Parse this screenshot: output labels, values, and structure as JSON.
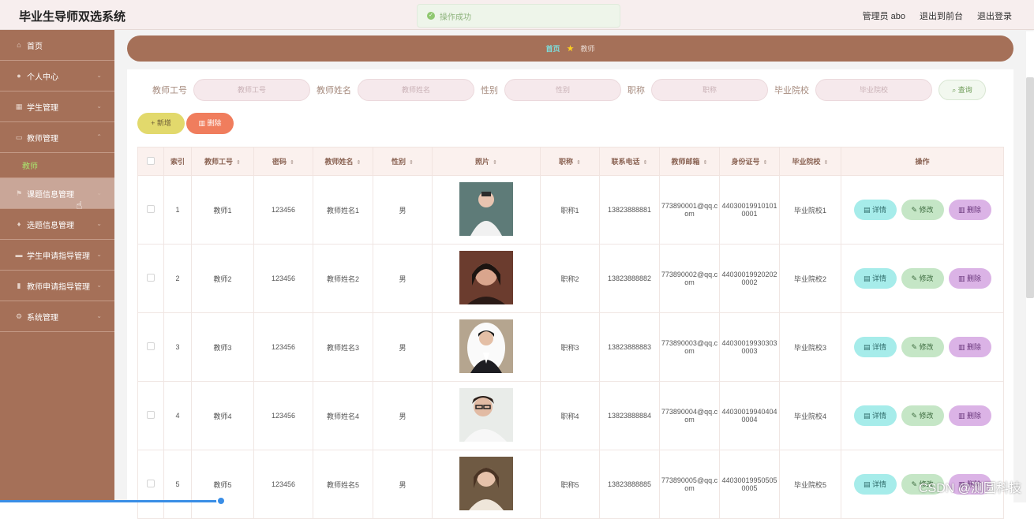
{
  "app": {
    "title": "毕业生导师双选系统",
    "toast": "操作成功",
    "user_label": "管理员 abo",
    "back_front": "退出到前台",
    "logout": "退出登录"
  },
  "sidebar": {
    "items": [
      {
        "label": "首页",
        "icon": "home-icon",
        "glyph": "⌂"
      },
      {
        "label": "个人中心",
        "icon": "user-icon",
        "glyph": "●"
      },
      {
        "label": "学生管理",
        "icon": "grid-icon",
        "glyph": "▦"
      },
      {
        "label": "教师管理",
        "icon": "chat-icon",
        "glyph": "▭"
      },
      {
        "label": "课题信息管理",
        "icon": "flag-icon",
        "glyph": "⚑"
      },
      {
        "label": "选题信息管理",
        "icon": "mic-icon",
        "glyph": "♦"
      },
      {
        "label": "学生申请指导管理",
        "icon": "book-icon",
        "glyph": "▬"
      },
      {
        "label": "教师申请指导管理",
        "icon": "bar-chart-icon",
        "glyph": "▮"
      },
      {
        "label": "系统管理",
        "icon": "settings-icon",
        "glyph": "⚙"
      }
    ],
    "submenu": "教师"
  },
  "breadcrumb": {
    "home": "首页",
    "current": "教师"
  },
  "search": {
    "fields": [
      {
        "label": "教师工号",
        "placeholder": "教师工号"
      },
      {
        "label": "教师姓名",
        "placeholder": "教师姓名"
      },
      {
        "label": "性别",
        "placeholder": "性别"
      },
      {
        "label": "职称",
        "placeholder": "职称"
      },
      {
        "label": "毕业院校",
        "placeholder": "毕业院校"
      }
    ],
    "button": "查询"
  },
  "actions": {
    "add": "新增",
    "delete": "删除"
  },
  "table": {
    "headers": [
      "索引",
      "教师工号",
      "密码",
      "教师姓名",
      "性别",
      "照片",
      "职称",
      "联系电话",
      "教师邮箱",
      "身份证号",
      "毕业院校",
      "操作"
    ],
    "rows": [
      {
        "idx": "1",
        "id": "教师1",
        "pwd": "123456",
        "name": "教师姓名1",
        "sex": "男",
        "title": "职称1",
        "phone": "13823888881",
        "email": "773890001@qq.com",
        "idcard": "440300199101010001",
        "school": "毕业院校1"
      },
      {
        "idx": "2",
        "id": "教师2",
        "pwd": "123456",
        "name": "教师姓名2",
        "sex": "男",
        "title": "职称2",
        "phone": "13823888882",
        "email": "773890002@qq.com",
        "idcard": "440300199202020002",
        "school": "毕业院校2"
      },
      {
        "idx": "3",
        "id": "教师3",
        "pwd": "123456",
        "name": "教师姓名3",
        "sex": "男",
        "title": "职称3",
        "phone": "13823888883",
        "email": "773890003@qq.com",
        "idcard": "440300199303030003",
        "school": "毕业院校3"
      },
      {
        "idx": "4",
        "id": "教师4",
        "pwd": "123456",
        "name": "教师姓名4",
        "sex": "男",
        "title": "职称4",
        "phone": "13823888884",
        "email": "773890004@qq.com",
        "idcard": "440300199404040004",
        "school": "毕业院校4"
      },
      {
        "idx": "5",
        "id": "教师5",
        "pwd": "123456",
        "name": "教师姓名5",
        "sex": "男",
        "title": "职称5",
        "phone": "13823888885",
        "email": "773890005@qq.com",
        "idcard": "440300199505050005",
        "school": "毕业院校5"
      }
    ],
    "ops": {
      "detail": "详情",
      "edit": "修改",
      "delete": "删除"
    }
  },
  "watermark": "CSDN @测圆科技",
  "colors": {
    "sidebar_bg": "#a57058",
    "accent_teal": "#a6ecea",
    "accent_green": "#c5e6c6",
    "accent_purple": "#dbb3e6",
    "add_yellow": "#e2d96c",
    "delete_orange": "#f07d5d"
  }
}
